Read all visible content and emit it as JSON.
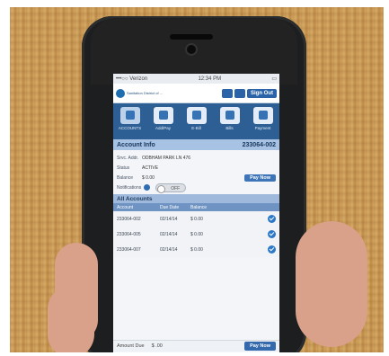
{
  "status_bar": {
    "carrier": "•••○○ Verizon",
    "time": "12:34 PM"
  },
  "header": {
    "logo_text": "Sanitation District of ...",
    "sign_out": "Sign Out"
  },
  "nav": [
    {
      "label": "ACCOUNTS",
      "icon": "accounts-icon"
    },
    {
      "label": "Add/Pay",
      "icon": "user-icon"
    },
    {
      "label": "E-Bill",
      "icon": "mail-icon"
    },
    {
      "label": "Bills",
      "icon": "search-icon"
    },
    {
      "label": "Payment",
      "icon": "dollar-icon"
    }
  ],
  "account_info": {
    "title": "Account Info",
    "number": "233064-002",
    "service_label": "Srvc. Addr.",
    "service_value": "ODBHAM PARK LN 476",
    "status_label": "Status",
    "status_value": "ACTIVE",
    "balance_label": "Balance",
    "balance_value": "$ 0.00",
    "pay_now": "Pay Now",
    "notifications_label": "Notifications",
    "toggle": "OFF"
  },
  "accounts": {
    "title": "All Accounts",
    "columns": [
      "Account",
      "Due Date",
      "Balance"
    ],
    "rows": [
      {
        "account": "233064-002",
        "due": "02/14/14",
        "balance": "$ 0.00"
      },
      {
        "account": "233064-005",
        "due": "02/14/14",
        "balance": "$ 0.00"
      },
      {
        "account": "233064-007",
        "due": "02/14/14",
        "balance": "$ 0.00"
      }
    ]
  },
  "footer": {
    "amount_label": "Amount Due",
    "amount": "$ .00",
    "pay_now": "Pay Now"
  },
  "colors": {
    "accent": "#2d5f95",
    "header_bar": "#a8c2e3",
    "button": "#3469ad"
  }
}
